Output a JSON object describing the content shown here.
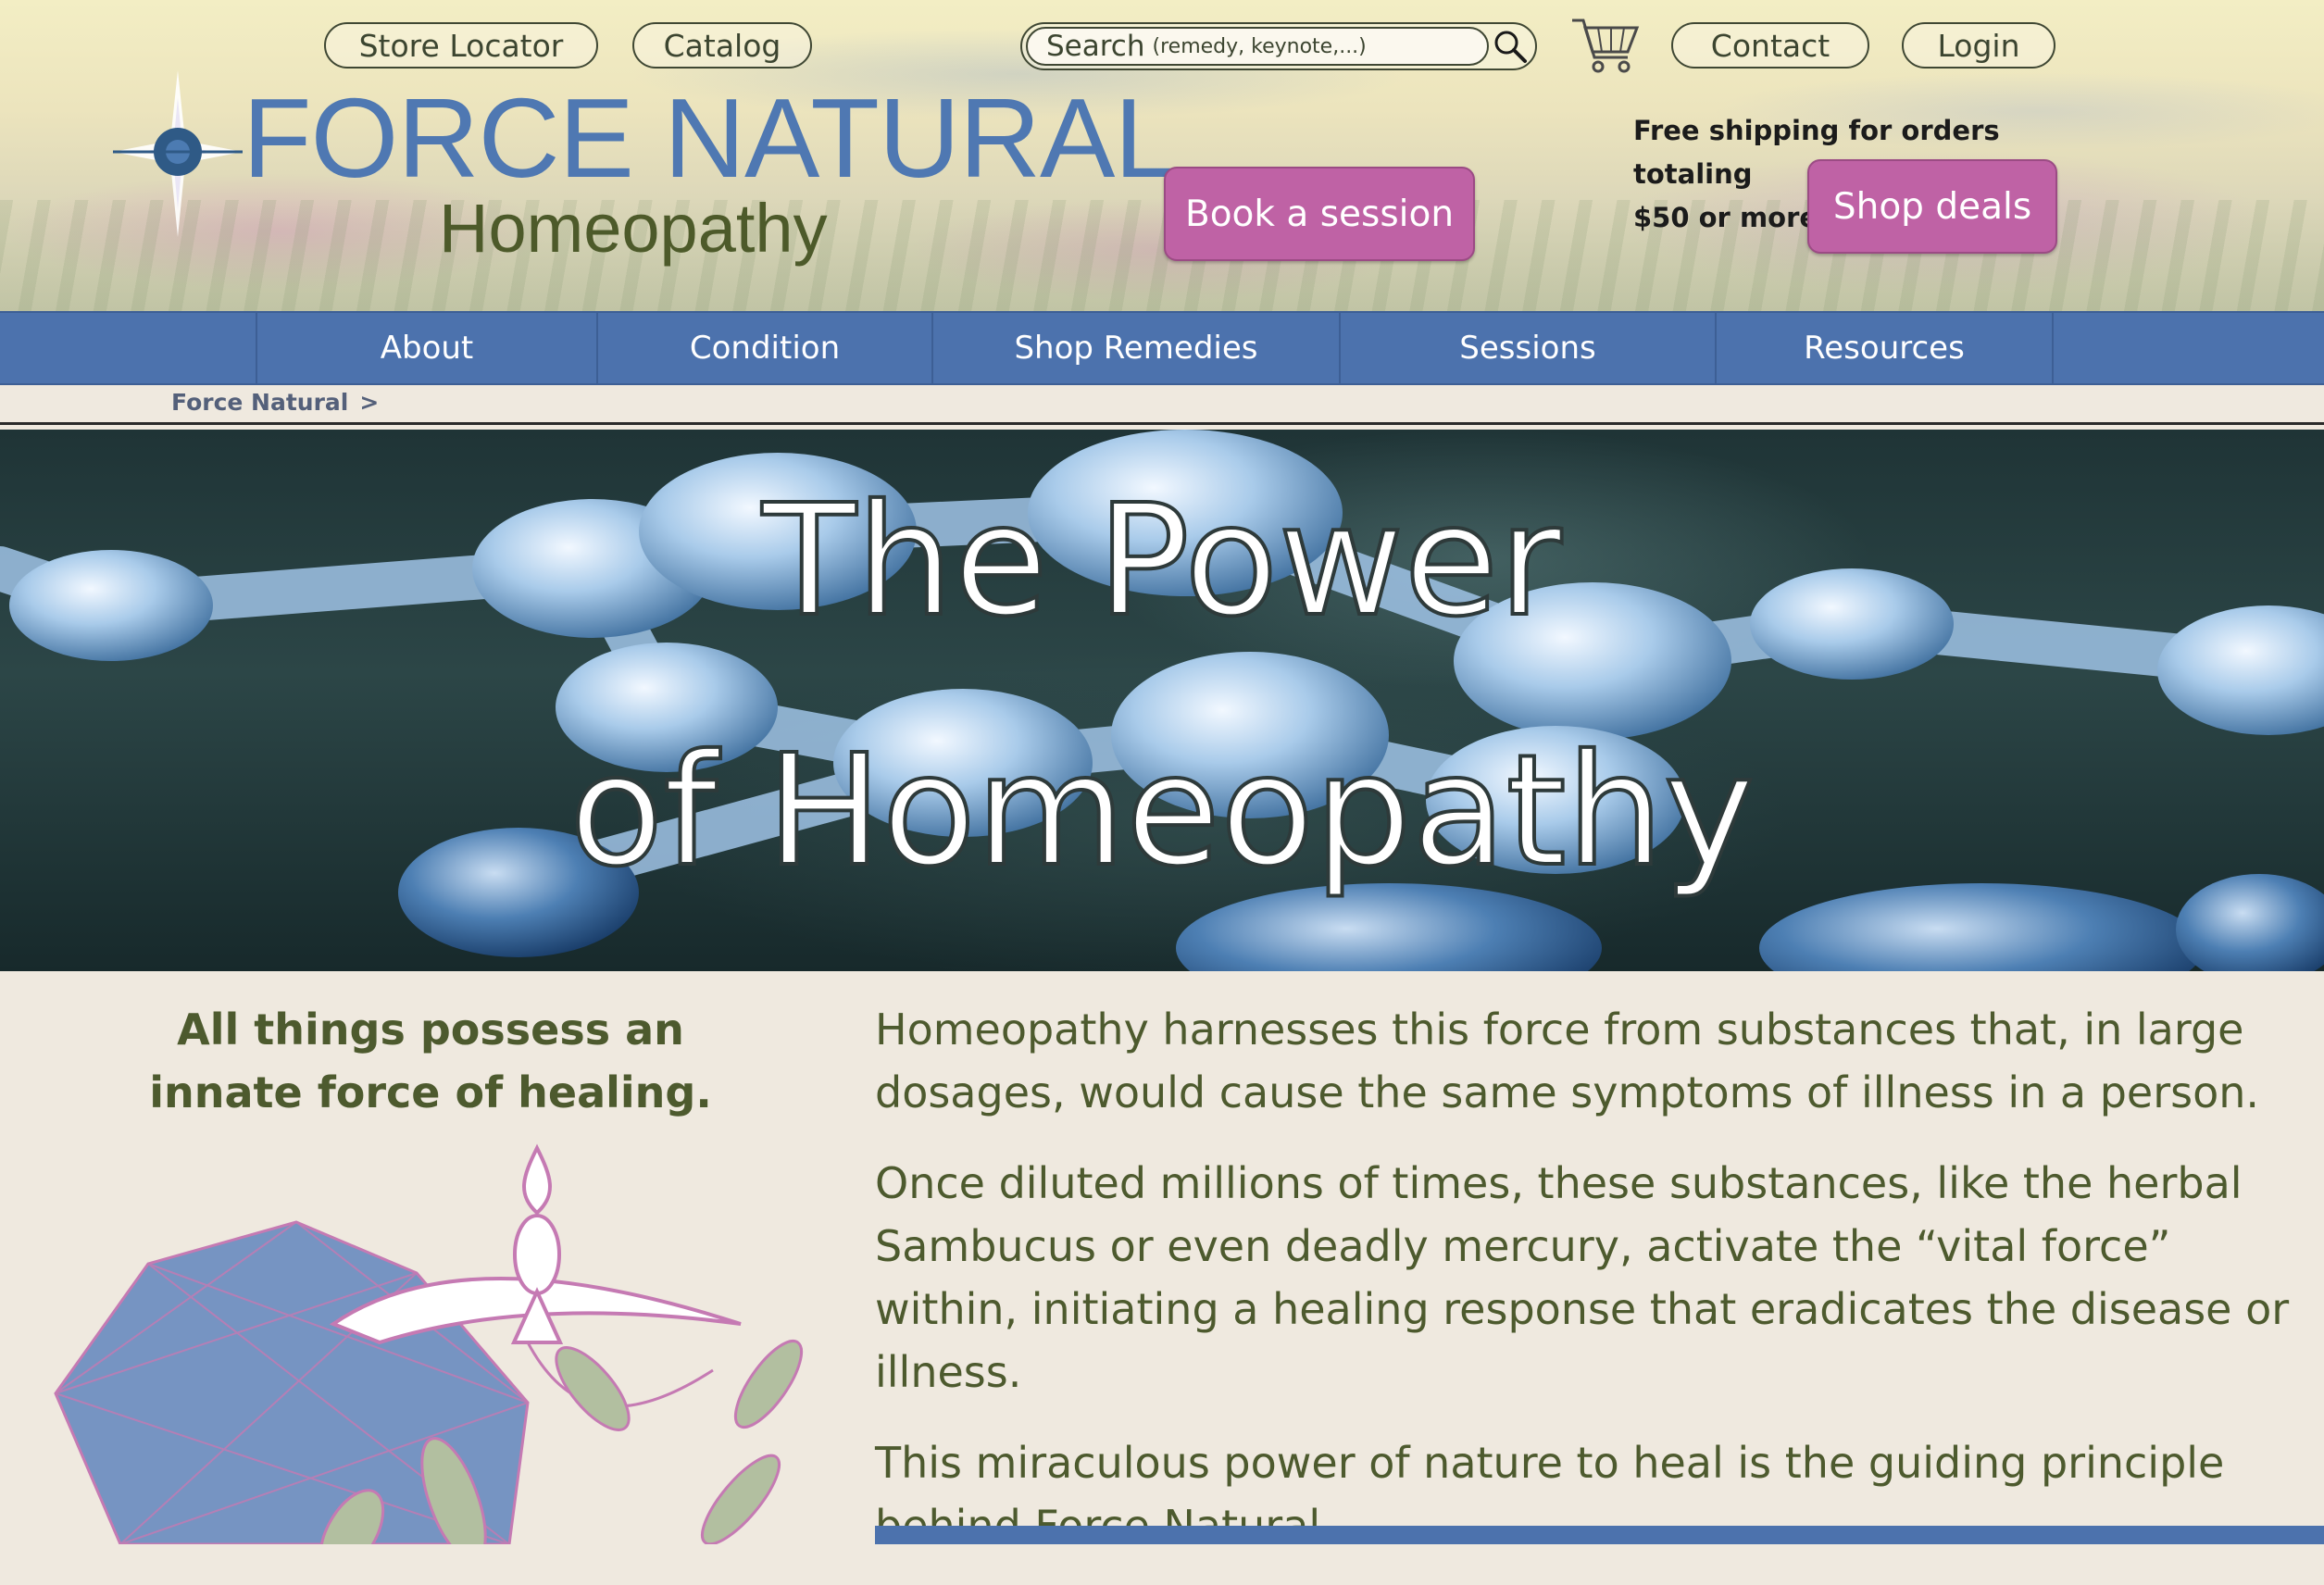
{
  "header": {
    "top_links": {
      "store_locator": "Store Locator",
      "catalog": "Catalog",
      "contact": "Contact",
      "login": "Login"
    },
    "search": {
      "label": "Search",
      "hint": "(remedy, keynote,...)"
    },
    "logo": {
      "title": "FORCE NATURAL",
      "subtitle": "Homeopathy"
    },
    "book_session": "Book a session",
    "shipping_note_line1": "Free shipping for orders totaling",
    "shipping_note_line2": "$50 or more!",
    "shop_deals": "Shop deals"
  },
  "nav": {
    "items": [
      {
        "label": "About"
      },
      {
        "label": "Condition"
      },
      {
        "label": "Shop Remedies"
      },
      {
        "label": "Sessions"
      },
      {
        "label": "Resources"
      }
    ]
  },
  "breadcrumb": {
    "home": "Force Natural",
    "separator": ">"
  },
  "hero": {
    "line1": "The Power",
    "line2": "of Homeopathy"
  },
  "content": {
    "tagline_line1": "All things possess an",
    "tagline_line2": "innate force of healing.",
    "paragraphs": [
      "Homeopathy harnesses this force from substances that, in large dosages, would cause the same symptoms of illness in a person.",
      "Once diluted millions of times, these substances, like the herbal Sambucus or even deadly mercury, activate the “vital force” within, initiating a healing response that eradicates the disease or illness.",
      "This miraculous power of nature to heal is the guiding principle behind Force Natural."
    ]
  },
  "colors": {
    "nav_blue": "#4c72ad",
    "cta_pink": "#bf62a5",
    "olive_text": "#4d5a2e",
    "logo_blue": "#4f78b2",
    "page_bg": "#efe9df"
  },
  "icons": {
    "search": "magnifier-icon",
    "cart": "shopping-cart-icon",
    "logo": "star-burst-icon"
  }
}
